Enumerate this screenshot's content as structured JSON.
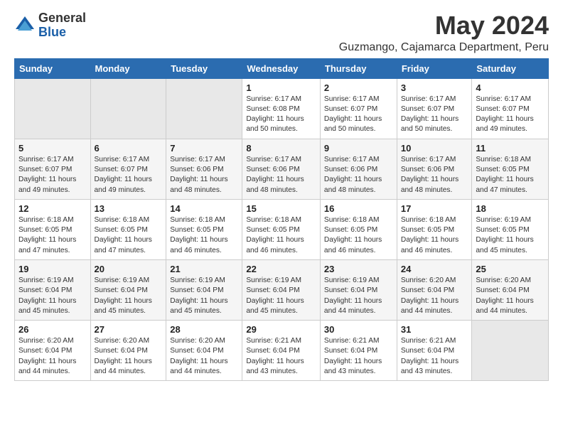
{
  "header": {
    "logo_general": "General",
    "logo_blue": "Blue",
    "month_year": "May 2024",
    "location": "Guzmango, Cajamarca Department, Peru"
  },
  "days_of_week": [
    "Sunday",
    "Monday",
    "Tuesday",
    "Wednesday",
    "Thursday",
    "Friday",
    "Saturday"
  ],
  "weeks": [
    [
      {
        "day": "",
        "empty": true
      },
      {
        "day": "",
        "empty": true
      },
      {
        "day": "",
        "empty": true
      },
      {
        "day": "1",
        "sunrise": "6:17 AM",
        "sunset": "6:08 PM",
        "daylight": "11 hours and 50 minutes."
      },
      {
        "day": "2",
        "sunrise": "6:17 AM",
        "sunset": "6:07 PM",
        "daylight": "11 hours and 50 minutes."
      },
      {
        "day": "3",
        "sunrise": "6:17 AM",
        "sunset": "6:07 PM",
        "daylight": "11 hours and 50 minutes."
      },
      {
        "day": "4",
        "sunrise": "6:17 AM",
        "sunset": "6:07 PM",
        "daylight": "11 hours and 49 minutes."
      }
    ],
    [
      {
        "day": "5",
        "sunrise": "6:17 AM",
        "sunset": "6:07 PM",
        "daylight": "11 hours and 49 minutes."
      },
      {
        "day": "6",
        "sunrise": "6:17 AM",
        "sunset": "6:07 PM",
        "daylight": "11 hours and 49 minutes."
      },
      {
        "day": "7",
        "sunrise": "6:17 AM",
        "sunset": "6:06 PM",
        "daylight": "11 hours and 48 minutes."
      },
      {
        "day": "8",
        "sunrise": "6:17 AM",
        "sunset": "6:06 PM",
        "daylight": "11 hours and 48 minutes."
      },
      {
        "day": "9",
        "sunrise": "6:17 AM",
        "sunset": "6:06 PM",
        "daylight": "11 hours and 48 minutes."
      },
      {
        "day": "10",
        "sunrise": "6:17 AM",
        "sunset": "6:06 PM",
        "daylight": "11 hours and 48 minutes."
      },
      {
        "day": "11",
        "sunrise": "6:18 AM",
        "sunset": "6:05 PM",
        "daylight": "11 hours and 47 minutes."
      }
    ],
    [
      {
        "day": "12",
        "sunrise": "6:18 AM",
        "sunset": "6:05 PM",
        "daylight": "11 hours and 47 minutes."
      },
      {
        "day": "13",
        "sunrise": "6:18 AM",
        "sunset": "6:05 PM",
        "daylight": "11 hours and 47 minutes."
      },
      {
        "day": "14",
        "sunrise": "6:18 AM",
        "sunset": "6:05 PM",
        "daylight": "11 hours and 46 minutes."
      },
      {
        "day": "15",
        "sunrise": "6:18 AM",
        "sunset": "6:05 PM",
        "daylight": "11 hours and 46 minutes."
      },
      {
        "day": "16",
        "sunrise": "6:18 AM",
        "sunset": "6:05 PM",
        "daylight": "11 hours and 46 minutes."
      },
      {
        "day": "17",
        "sunrise": "6:18 AM",
        "sunset": "6:05 PM",
        "daylight": "11 hours and 46 minutes."
      },
      {
        "day": "18",
        "sunrise": "6:19 AM",
        "sunset": "6:05 PM",
        "daylight": "11 hours and 45 minutes."
      }
    ],
    [
      {
        "day": "19",
        "sunrise": "6:19 AM",
        "sunset": "6:04 PM",
        "daylight": "11 hours and 45 minutes."
      },
      {
        "day": "20",
        "sunrise": "6:19 AM",
        "sunset": "6:04 PM",
        "daylight": "11 hours and 45 minutes."
      },
      {
        "day": "21",
        "sunrise": "6:19 AM",
        "sunset": "6:04 PM",
        "daylight": "11 hours and 45 minutes."
      },
      {
        "day": "22",
        "sunrise": "6:19 AM",
        "sunset": "6:04 PM",
        "daylight": "11 hours and 45 minutes."
      },
      {
        "day": "23",
        "sunrise": "6:19 AM",
        "sunset": "6:04 PM",
        "daylight": "11 hours and 44 minutes."
      },
      {
        "day": "24",
        "sunrise": "6:20 AM",
        "sunset": "6:04 PM",
        "daylight": "11 hours and 44 minutes."
      },
      {
        "day": "25",
        "sunrise": "6:20 AM",
        "sunset": "6:04 PM",
        "daylight": "11 hours and 44 minutes."
      }
    ],
    [
      {
        "day": "26",
        "sunrise": "6:20 AM",
        "sunset": "6:04 PM",
        "daylight": "11 hours and 44 minutes."
      },
      {
        "day": "27",
        "sunrise": "6:20 AM",
        "sunset": "6:04 PM",
        "daylight": "11 hours and 44 minutes."
      },
      {
        "day": "28",
        "sunrise": "6:20 AM",
        "sunset": "6:04 PM",
        "daylight": "11 hours and 44 minutes."
      },
      {
        "day": "29",
        "sunrise": "6:21 AM",
        "sunset": "6:04 PM",
        "daylight": "11 hours and 43 minutes."
      },
      {
        "day": "30",
        "sunrise": "6:21 AM",
        "sunset": "6:04 PM",
        "daylight": "11 hours and 43 minutes."
      },
      {
        "day": "31",
        "sunrise": "6:21 AM",
        "sunset": "6:04 PM",
        "daylight": "11 hours and 43 minutes."
      },
      {
        "day": "",
        "empty": true
      }
    ]
  ],
  "labels": {
    "sunrise_label": "Sunrise:",
    "sunset_label": "Sunset:",
    "daylight_label": "Daylight:"
  }
}
